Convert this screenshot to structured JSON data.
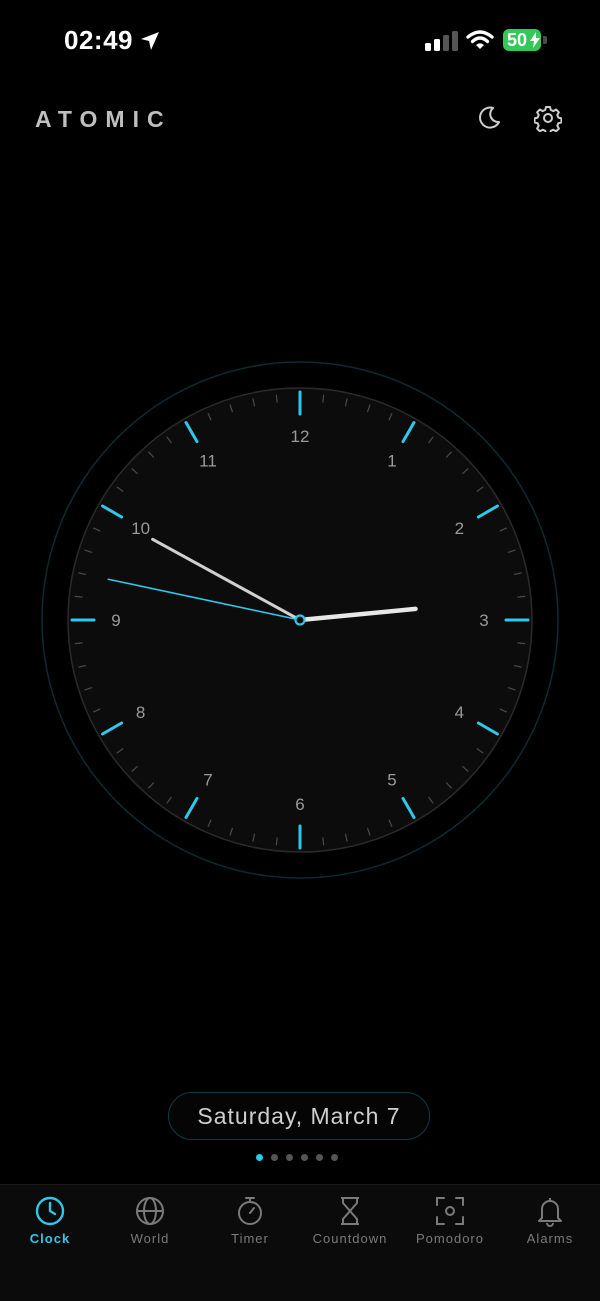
{
  "status_bar": {
    "time": "02:49",
    "battery": "50"
  },
  "header": {
    "title": "ATOMIC"
  },
  "clock": {
    "numerals": [
      "12",
      "1",
      "2",
      "3",
      "4",
      "5",
      "6",
      "7",
      "8",
      "9",
      "10",
      "11"
    ],
    "time": {
      "hour": 2,
      "minute": 49,
      "second": 47
    },
    "accent_color": "#2ec8ea"
  },
  "date": "Saturday, March 7",
  "pages": {
    "count": 6,
    "active": 0
  },
  "tabs": [
    {
      "label": "Clock",
      "icon": "clock-icon",
      "active": true
    },
    {
      "label": "World",
      "icon": "globe-icon",
      "active": false
    },
    {
      "label": "Timer",
      "icon": "stopwatch-icon",
      "active": false
    },
    {
      "label": "Countdown",
      "icon": "hourglass-icon",
      "active": false
    },
    {
      "label": "Pomodoro",
      "icon": "focus-icon",
      "active": false
    },
    {
      "label": "Alarms",
      "icon": "bell-icon",
      "active": false
    }
  ],
  "colors": {
    "accent": "#2ec8ea",
    "background": "#000000",
    "battery": "#34c759"
  }
}
